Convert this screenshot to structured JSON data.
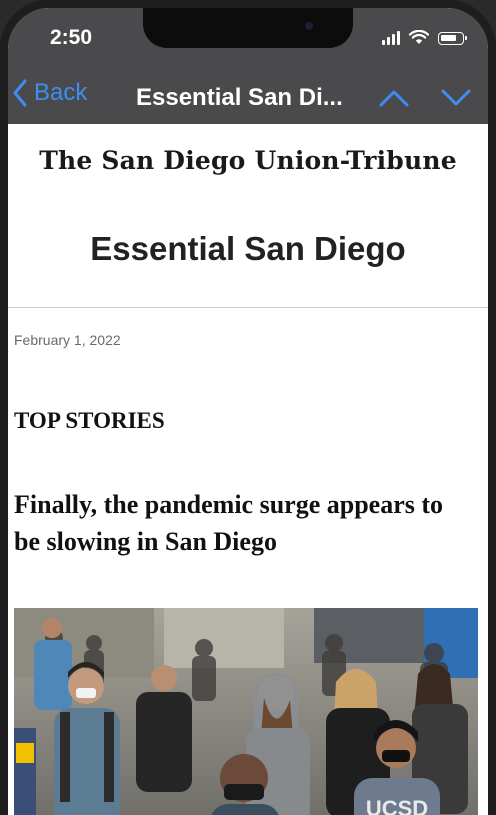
{
  "status_bar": {
    "time": "2:50"
  },
  "nav": {
    "back_label": "Back",
    "title": "Essential San Di..."
  },
  "newsletter": {
    "masthead": "The San Diego Union-Tribune",
    "title": "Essential San Diego",
    "date": "February 1, 2022",
    "section": "TOP STORIES",
    "story_headline": "Finally, the pandemic surge appears to be slowing in San Diego",
    "photo_sign_text": "UCSD"
  },
  "colors": {
    "accent": "#3d8ef0",
    "nav_bar": "#4a4a4c"
  }
}
